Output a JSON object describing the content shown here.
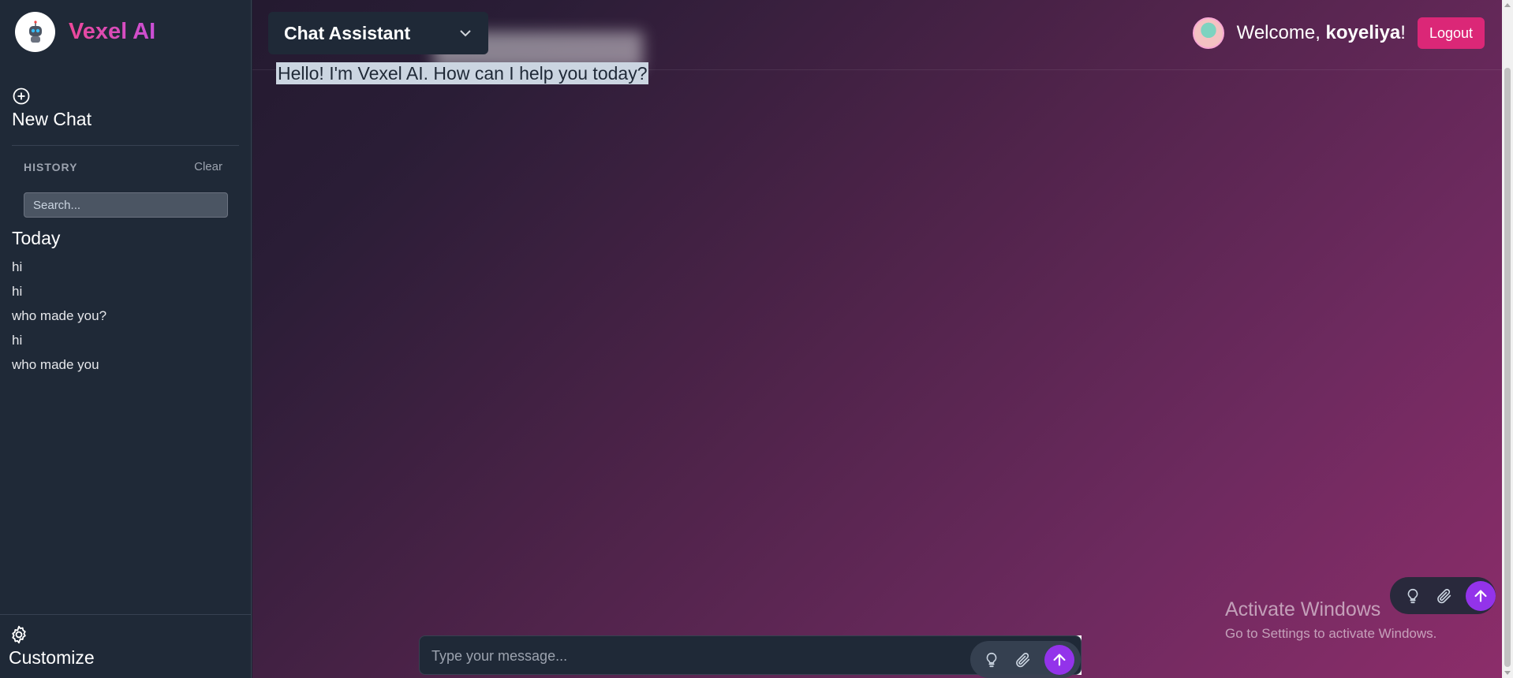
{
  "brand": {
    "name": "Vexel AI",
    "logo_icon": "robot-icon"
  },
  "sidebar": {
    "new_chat_label": "New Chat",
    "history_title": "HISTORY",
    "clear_label": "Clear",
    "search_placeholder": "Search...",
    "group_title": "Today",
    "history_items": [
      "hi",
      "hi",
      "who made you?",
      "hi",
      "who made you"
    ],
    "customize_label": "Customize"
  },
  "header": {
    "model_selected": "Chat Assistant",
    "welcome_prefix": "Welcome, ",
    "username": "koyeliya",
    "welcome_suffix": "!",
    "logout_label": "Logout"
  },
  "chat": {
    "greeting": "Hello! I'm Vexel AI. How can I help you today?",
    "input_placeholder": "Type your message..."
  },
  "watermark": {
    "title": "Activate Windows",
    "subtitle": "Go to Settings to activate Windows."
  },
  "colors": {
    "accent_pink": "#db2777",
    "send_purple": "#9333ea",
    "sidebar_bg": "#1f2937"
  }
}
